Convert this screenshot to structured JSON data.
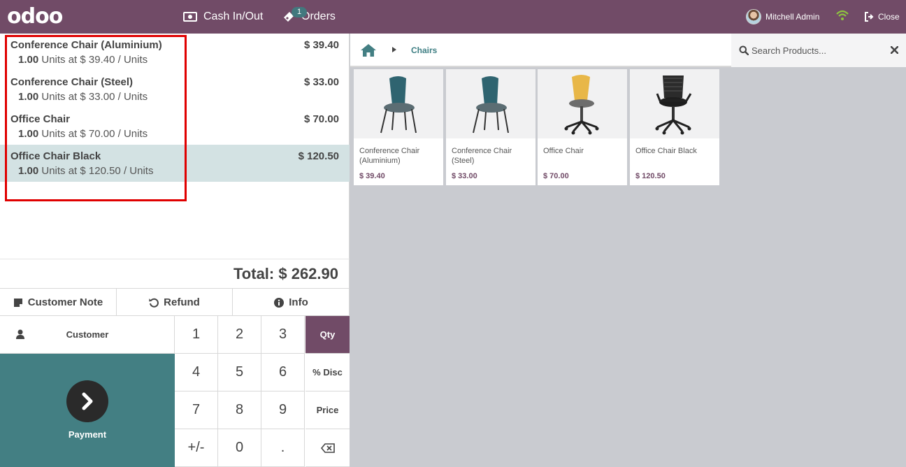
{
  "header": {
    "logo": "odoo",
    "cash_label": "Cash In/Out",
    "orders_label": "Orders",
    "orders_count": "1",
    "user_name": "Mitchell Admin",
    "close_label": "Close"
  },
  "order": {
    "lines": [
      {
        "name": "Conference Chair (Aluminium)",
        "price": "$ 39.40",
        "qty": "1.00",
        "detail": " Units at $ 39.40 / Units"
      },
      {
        "name": "Conference Chair (Steel)",
        "price": "$ 33.00",
        "qty": "1.00",
        "detail": " Units at $ 33.00 / Units"
      },
      {
        "name": "Office Chair",
        "price": "$ 70.00",
        "qty": "1.00",
        "detail": " Units at $ 70.00 / Units"
      },
      {
        "name": "Office Chair Black",
        "price": "$ 120.50",
        "qty": "1.00",
        "detail": " Units at $ 120.50 / Units"
      }
    ],
    "total": "Total: $ 262.90"
  },
  "controls": {
    "customer_note": "Customer Note",
    "refund": "Refund",
    "info": "Info",
    "customer": "Customer",
    "payment": "Payment"
  },
  "numpad": {
    "keys": [
      "1",
      "2",
      "3",
      "4",
      "5",
      "6",
      "7",
      "8",
      "9",
      "+/-",
      "0",
      "."
    ],
    "modes": [
      "Qty",
      "% Disc",
      "Price"
    ],
    "active_mode": "Qty"
  },
  "catalog": {
    "breadcrumb": "Chairs",
    "search_placeholder": "Search Products...",
    "products": [
      {
        "name": "Conference Chair (Aluminium)",
        "price": "$ 39.40"
      },
      {
        "name": "Conference Chair (Steel)",
        "price": "$ 33.00"
      },
      {
        "name": "Office Chair",
        "price": "$ 70.00"
      },
      {
        "name": "Office Chair Black",
        "price": "$ 120.50"
      }
    ]
  },
  "colors": {
    "brand": "#714b67",
    "teal": "#437f83",
    "selected_line": "#d3e2e3",
    "highlight": "#e00000"
  }
}
